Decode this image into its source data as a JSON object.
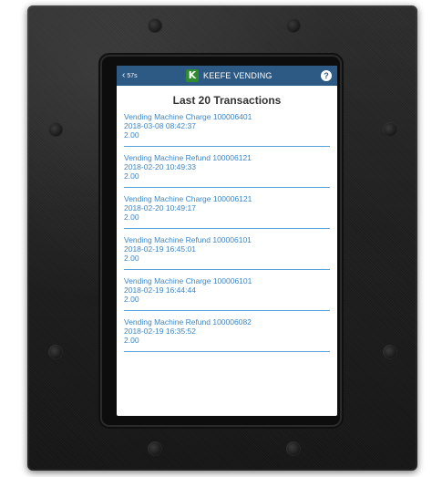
{
  "header": {
    "back_label": "57s",
    "brand_initial": "K",
    "brand_name": "KEEFE VENDING",
    "help_glyph": "?"
  },
  "page": {
    "title": "Last 20 Transactions"
  },
  "transactions": [
    {
      "description": "Vending Machine Charge 100006401",
      "datetime": "2018-03-08 08:42:37",
      "amount": "2.00"
    },
    {
      "description": "Vending Machine Refund 100006121",
      "datetime": "2018-02-20 10:49:33",
      "amount": "2.00"
    },
    {
      "description": "Vending Machine Charge 100006121",
      "datetime": "2018-02-20 10:49:17",
      "amount": "2.00"
    },
    {
      "description": "Vending Machine Refund 100006101",
      "datetime": "2018-02-19 16:45:01",
      "amount": "2.00"
    },
    {
      "description": "Vending Machine Charge 100006101",
      "datetime": "2018-02-19 16:44:44",
      "amount": "2.00"
    },
    {
      "description": "Vending Machine Refund 100006082",
      "datetime": "2018-02-19 16:35:52",
      "amount": "2.00"
    }
  ],
  "colors": {
    "header_bg": "#2d5a84",
    "link_text": "#3b86c6",
    "divider": "#5aa2d8",
    "logo_green": "#2e8b2e",
    "frame": "#1e1e1e"
  }
}
